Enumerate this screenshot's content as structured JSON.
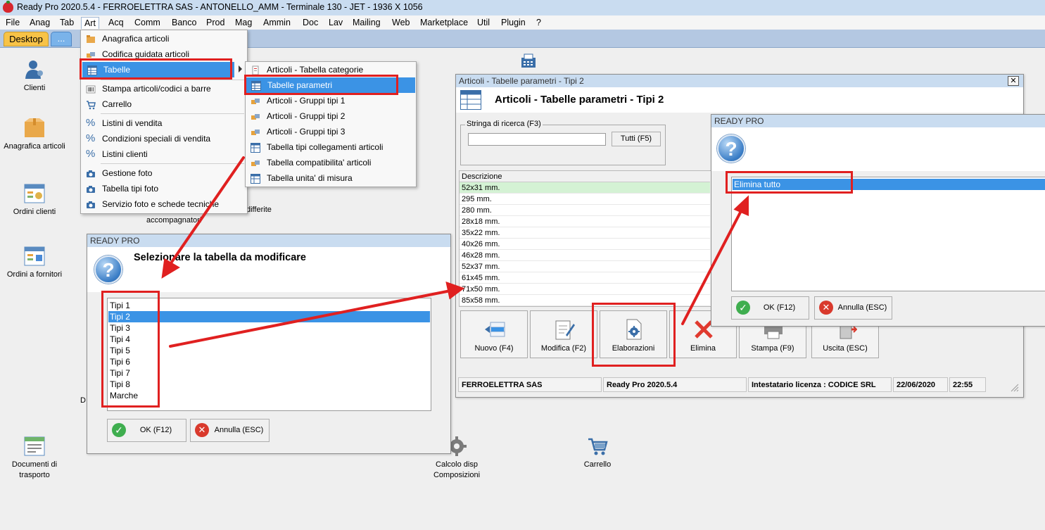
{
  "window": {
    "title": "Ready Pro 2020.5.4 - FERROELETTRA SAS - ANTONELLO_AMM - Terminale 130 - JET - 1936 X 1056"
  },
  "menubar": [
    "File",
    "Anag",
    "Tab",
    "Art",
    "Acq",
    "Comm",
    "Banco",
    "Prod",
    "Mag",
    "Ammin",
    "Doc",
    "Lav",
    "Mailing",
    "Web",
    "Marketplace",
    "Util",
    "Plugin",
    "?"
  ],
  "tabs": {
    "desktop": "Desktop",
    "more": "..."
  },
  "desktop_icons": {
    "clienti": "Clienti",
    "anagrafica": "Anagrafica articoli",
    "ordini_clienti": "Ordini clienti",
    "ordini_fornitori": "Ordini a fornitori",
    "documenti_trasporto": "Documenti di trasporto",
    "calcolo": "Calcolo disp Composizioni",
    "carrello": "Carrello",
    "accompagnatori": "accompagnatori",
    "differite": "differite",
    "partial_d": "D"
  },
  "art_menu": [
    {
      "label": "Anagrafica articoli",
      "icon": "folder-icon"
    },
    {
      "label": "Codifica guidata articoli",
      "icon": "items-icon"
    },
    {
      "label": "Tabelle",
      "icon": "table-icon"
    },
    {
      "label": "Stampa articoli/codici a barre",
      "icon": "barcode-icon"
    },
    {
      "label": "Carrello",
      "icon": "cart-icon"
    },
    {
      "label": "Listini di vendita",
      "icon": "percent-icon"
    },
    {
      "label": "Condizioni speciali di vendita",
      "icon": "percent-icon"
    },
    {
      "label": "Listini clienti",
      "icon": "percent-icon"
    },
    {
      "label": "Gestione foto",
      "icon": "camera-icon"
    },
    {
      "label": "Tabella tipi foto",
      "icon": "camera-icon"
    },
    {
      "label": "Servizio foto e schede tecniche",
      "icon": "camera-icon"
    }
  ],
  "tabelle_submenu": [
    "Articoli - Tabella categorie",
    "Tabelle parametri",
    "Articoli - Gruppi tipi 1",
    "Articoli - Gruppi tipi 2",
    "Articoli - Gruppi tipi 3",
    "Tabella tipi collegamenti articoli",
    "Tabella compatibilita' articoli",
    "Tabella unita' di misura"
  ],
  "select_dialog": {
    "title": "READY PRO",
    "heading": "Selezionare la tabella da modificare",
    "items": [
      "Tipi 1",
      "Tipi 2",
      "Tipi 3",
      "Tipi 4",
      "Tipi 5",
      "Tipi 6",
      "Tipi 7",
      "Tipi 8",
      "Marche"
    ],
    "selected": "Tipi 2",
    "ok": "OK (F12)",
    "cancel": "Annulla (ESC)"
  },
  "param_window": {
    "title": "Articoli - Tabelle parametri - Tipi 2",
    "heading": "Articoli - Tabelle parametri - Tipi 2",
    "close": "✕",
    "search_legend": "Stringa di ricerca (F3)",
    "search_value": "",
    "all_button": "Tutti (F5)",
    "column": "Descrizione",
    "rows": [
      "52x31 mm.",
      "295 mm.",
      "280 mm.",
      "28x18 mm.",
      "35x22 mm.",
      "40x26 mm.",
      "46x28 mm.",
      "52x37 mm.",
      "61x45 mm.",
      "71x50 mm.",
      "85x58 mm."
    ],
    "buttons": [
      "Nuovo (F4)",
      "Modifica (F2)",
      "Elaborazioni",
      "Elimina",
      "Stampa (F9)",
      "Uscita (ESC)"
    ],
    "status": [
      "FERROELETTRA SAS",
      "Ready Pro 2020.5.4",
      "Intestatario licenza : CODICE SRL",
      "22/06/2020",
      "22:55"
    ]
  },
  "elab_dialog": {
    "title": "READY PRO",
    "items": [
      "Elimina tutto"
    ],
    "ok": "OK (F12)",
    "cancel": "Annulla (ESC)"
  },
  "colors": {
    "highlight": "#3b93e5",
    "annotation": "#e02020",
    "titlebar": "#c9dcf0",
    "desktop_tab": "#f7c347"
  }
}
